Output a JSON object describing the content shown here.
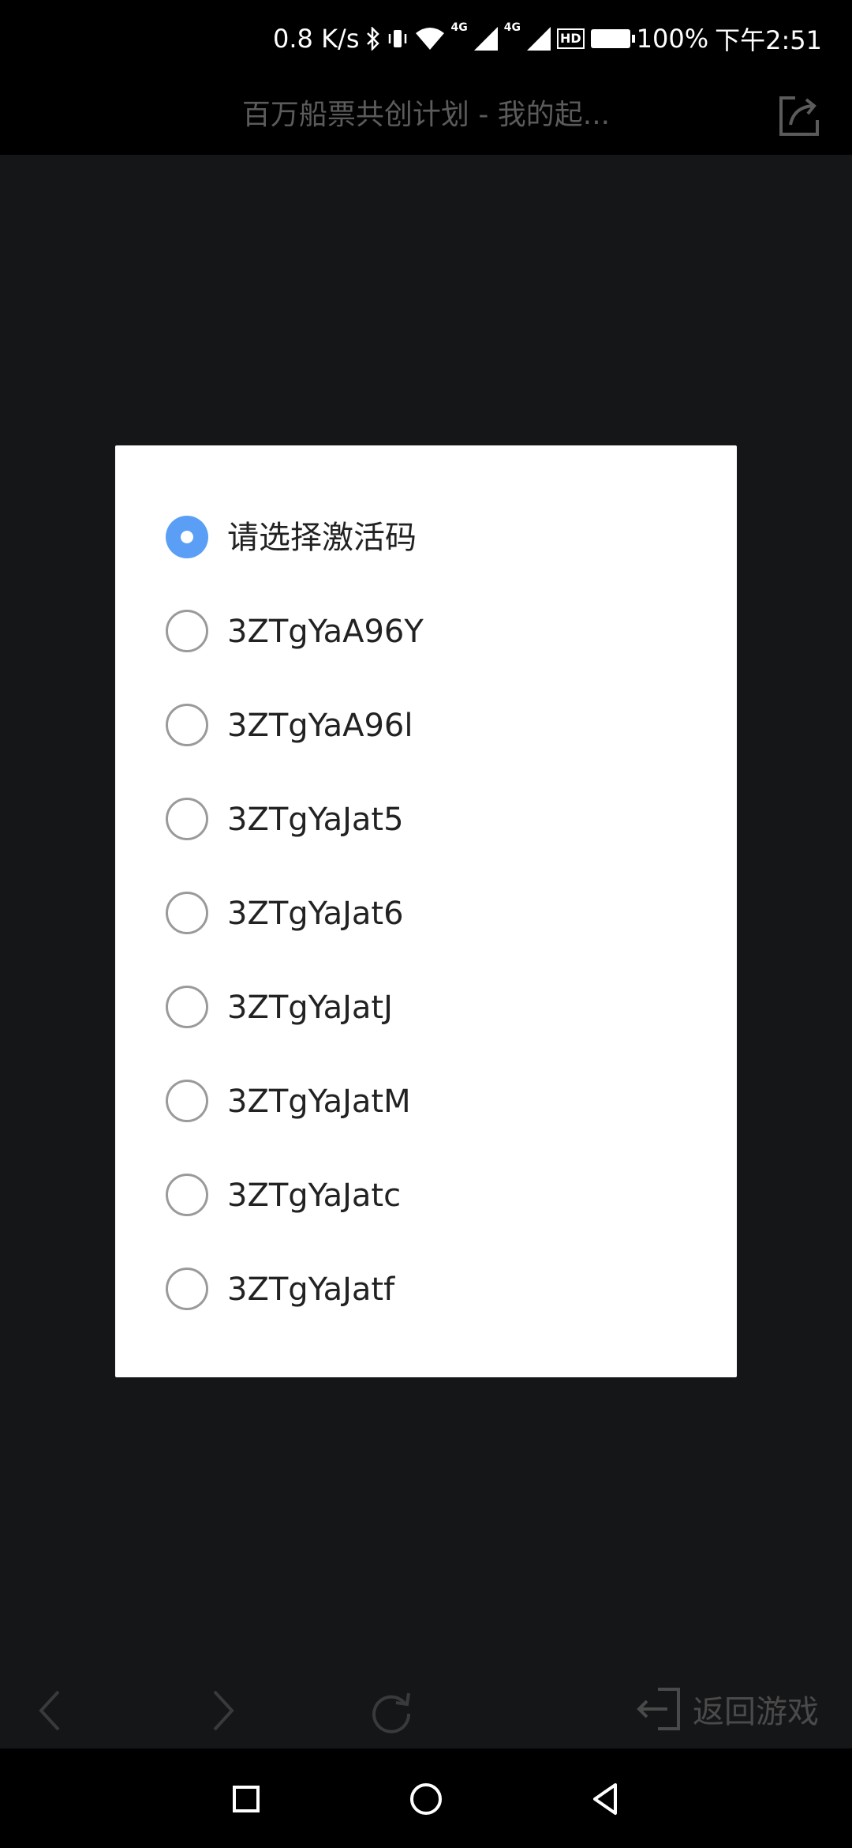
{
  "status_bar": {
    "net_speed": "0.8 K/s",
    "net_type_1": "4G",
    "net_type_2": "4G",
    "hd": "HD",
    "battery": "100%",
    "time": "下午2:51"
  },
  "title_bar": {
    "title": "百万船票共创计划 - 我的起...",
    "share_icon": "share-icon"
  },
  "dialog": {
    "options": [
      {
        "label": "请选择激活码",
        "checked": true
      },
      {
        "label": "3ZTgYaA96Y",
        "checked": false
      },
      {
        "label": "3ZTgYaA96l",
        "checked": false
      },
      {
        "label": "3ZTgYaJat5",
        "checked": false
      },
      {
        "label": "3ZTgYaJat6",
        "checked": false
      },
      {
        "label": "3ZTgYaJatJ",
        "checked": false
      },
      {
        "label": "3ZTgYaJatM",
        "checked": false
      },
      {
        "label": "3ZTgYaJatc",
        "checked": false
      },
      {
        "label": "3ZTgYaJatf",
        "checked": false
      }
    ]
  },
  "toolbar": {
    "back_game_label": "返回游戏"
  },
  "colors": {
    "accent": "#5a9ff5",
    "background": "#151618"
  }
}
